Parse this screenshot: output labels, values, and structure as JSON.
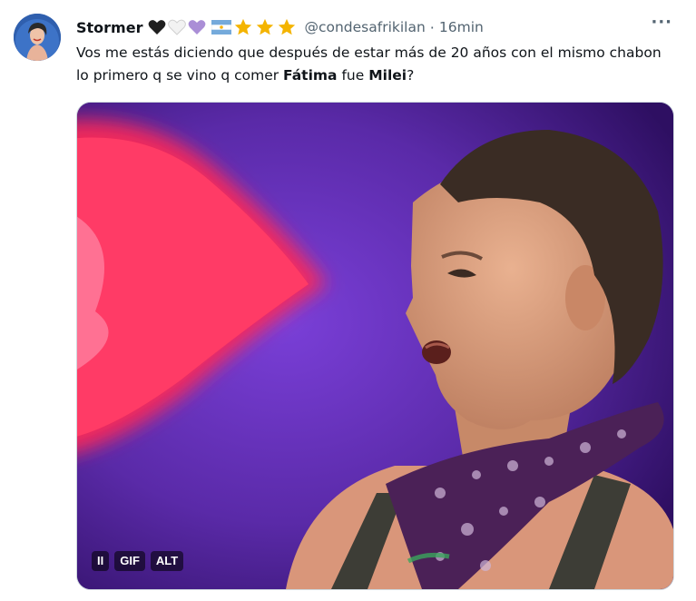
{
  "tweet": {
    "author_name": "Stormer",
    "author_emojis": [
      "black-heart",
      "white-heart",
      "purple-heart",
      "argentina-flag",
      "star",
      "star",
      "star"
    ],
    "handle": "@condesafrikilan",
    "separator": "·",
    "time": "16min",
    "more_label": "···",
    "text_parts": [
      {
        "text": "Vos me estás diciendo que después de estar más de 20 años con el mismo chabon lo primero q se vino q comer ",
        "bold": false
      },
      {
        "text": "Fátima",
        "bold": true
      },
      {
        "text": " fue ",
        "bold": false
      },
      {
        "text": "Milei",
        "bold": true
      },
      {
        "text": "?",
        "bold": false
      }
    ]
  },
  "media": {
    "type": "gif",
    "description_icon": "shocked-person-gif",
    "controls": {
      "pause": "II",
      "gif": "GIF",
      "alt": "ALT"
    }
  },
  "colors": {
    "text": "#0f1419",
    "muted": "#536471",
    "border": "#cfd9de",
    "star": "#f4b400",
    "purple_heart": "#aa8ed6"
  }
}
